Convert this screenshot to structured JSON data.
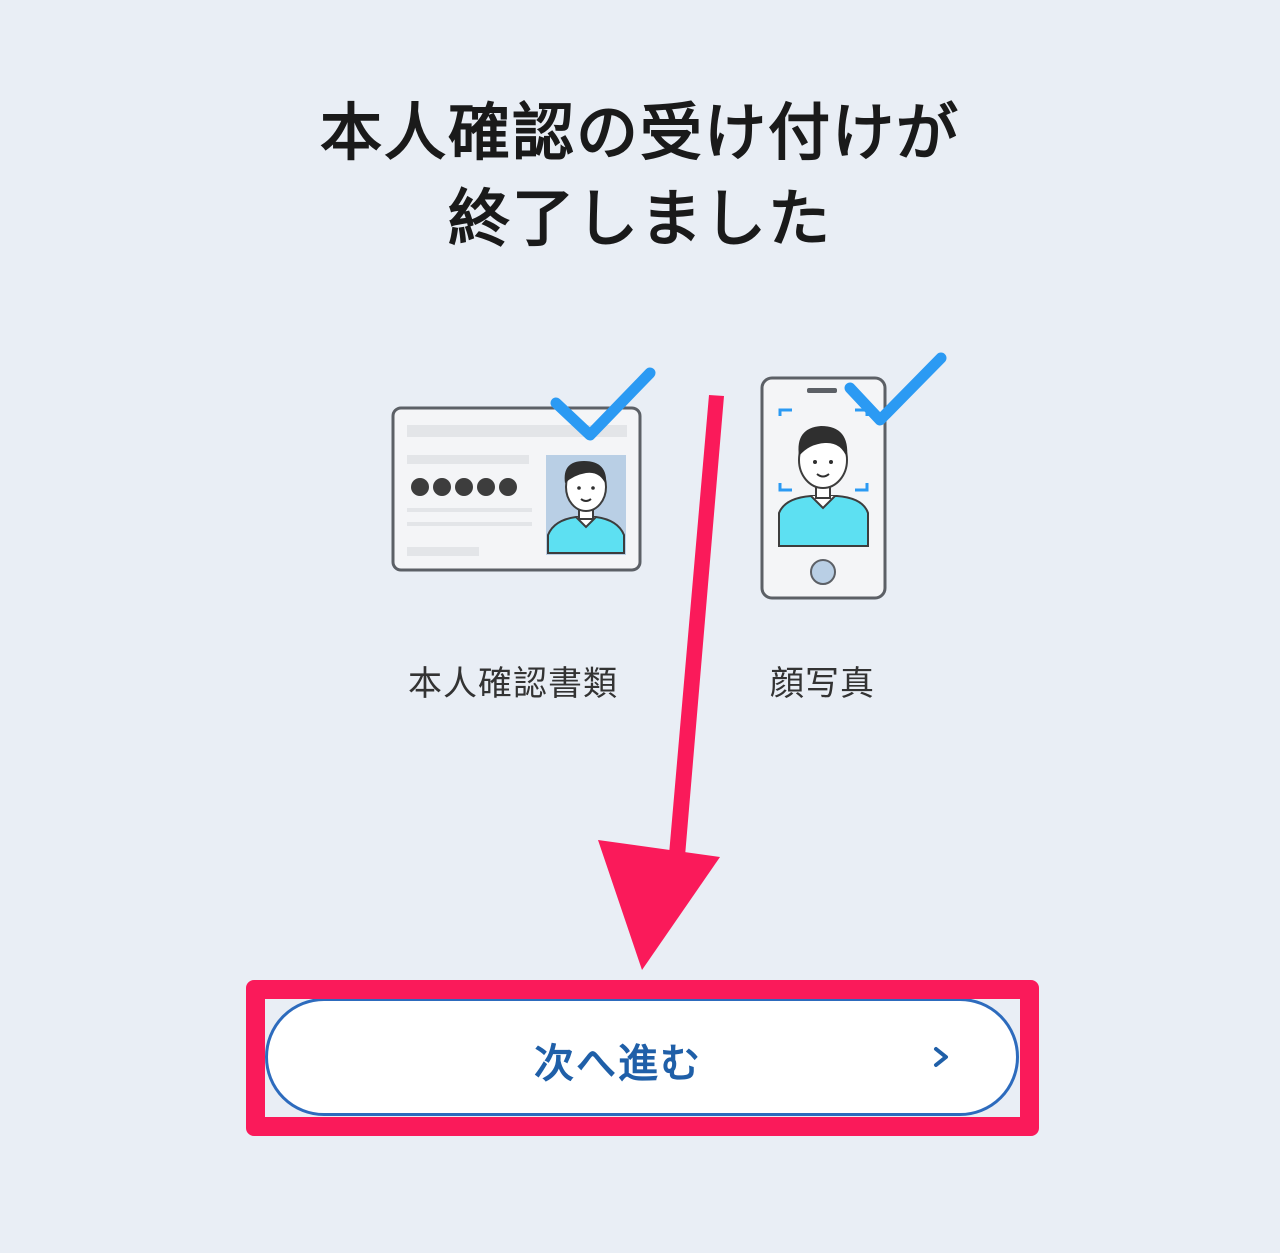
{
  "title": {
    "line1": "本人確認の受け付けが",
    "line2": "終了しました"
  },
  "items": [
    {
      "label": "本人確認書類",
      "icon": "id-card-icon",
      "status": "checked"
    },
    {
      "label": "顔写真",
      "icon": "face-photo-phone-icon",
      "status": "checked"
    }
  ],
  "next_button": {
    "label": "次へ進む",
    "icon": "chevron-right-icon"
  },
  "colors": {
    "background": "#e9eef5",
    "check": "#2b9af3",
    "button_text": "#1f5fa8",
    "button_border": "#2d6bbd",
    "annotation": "#fa1a5a"
  }
}
